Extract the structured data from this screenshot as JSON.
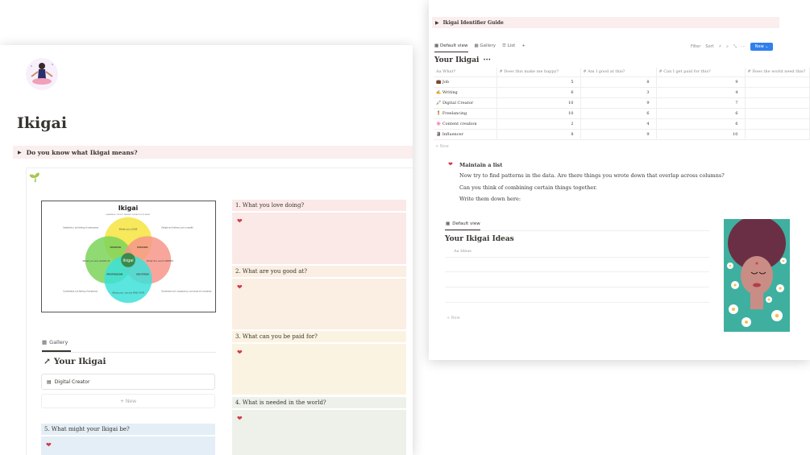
{
  "left": {
    "title": "Ikigai",
    "toggle": "Do you know what Ikigai means?",
    "diagram": {
      "title": "Ikigai",
      "subtitle": "A JAPANESE CONCEPT MEANING 'A REASON FOR BEING'",
      "center": "Ikigai",
      "circles": {
        "top": "What you LOVE",
        "left": "What you are GOOD AT",
        "right": "What the world NEEDS",
        "bottom": "What you can be PAID FOR"
      },
      "overlaps": {
        "passion": "PASSION",
        "mission": "MISSION",
        "profession": "PROFESSION",
        "vocation": "VOCATION"
      },
      "side_notes": {
        "tl": "Satisfaction, but feeling of uselessness",
        "tr": "Delight and fullness, but no wealth",
        "bl": "Comfortable, but feeling of emptiness",
        "br": "Excitement and complacency, but sense of uncertainty"
      }
    },
    "gallery_tab": "Gallery",
    "your_ikigai": "Your Ikigai",
    "card_label": "Digital Creator",
    "new_label": "+ New",
    "questions": [
      "1.  What you love doing?",
      "2.  What are you good at?",
      "3.  What can you be paid for?",
      "4.  What is needed in the world?"
    ],
    "q5": "5.  What might your Ikigai be?",
    "colors": {
      "q1": "#fbe9e7",
      "q2": "#fbeee3",
      "q3": "#fbf3e2",
      "q4": "#edf1ea",
      "q5": "#e4eef6"
    }
  },
  "right": {
    "toggle": "Ikigai Identifier Guide",
    "views": {
      "default": "Default view",
      "gallery": "Gallery",
      "list": "List",
      "add": "+"
    },
    "toolbar": {
      "filter": "Filter",
      "sort": "Sort",
      "new": "New"
    },
    "table_title": "Your Ikigai",
    "columns": [
      "Aa What?",
      "#  Does this make me happy?",
      "#  Am I good at this?",
      "#  Can I get paid for this?",
      "#  Does the world need this?"
    ],
    "rows": [
      {
        "icon": "💼",
        "name": "Job",
        "happy": "5",
        "good": "8",
        "paid": "9",
        "need": ""
      },
      {
        "icon": "✍",
        "name": "Writing",
        "happy": "6",
        "good": "3",
        "paid": "4",
        "need": ""
      },
      {
        "icon": "🖍",
        "name": "Digital Creator",
        "happy": "10",
        "good": "9",
        "paid": "7",
        "need": ""
      },
      {
        "icon": "🧍",
        "name": "Freelancing",
        "happy": "10",
        "good": "6",
        "paid": "6",
        "need": ""
      },
      {
        "icon": "🌸",
        "name": "Content creation",
        "happy": "2",
        "good": "4",
        "paid": "6",
        "need": ""
      },
      {
        "icon": "🗿",
        "name": "Influencer",
        "happy": "8",
        "good": "9",
        "paid": "10",
        "need": ""
      }
    ],
    "row_new": "+ New",
    "maintain": {
      "title": "Maintain a list",
      "line1": "Now try to find patterns in the data. Are there things you wrote down that overlap across columns?",
      "line2": "Can you think of combining certain things together.",
      "line3": "Write them down here:"
    },
    "ideas": {
      "tab": "Default view",
      "title": "Your Ikigai Ideas",
      "column": "Aa Ideas",
      "new": "+ New"
    }
  }
}
